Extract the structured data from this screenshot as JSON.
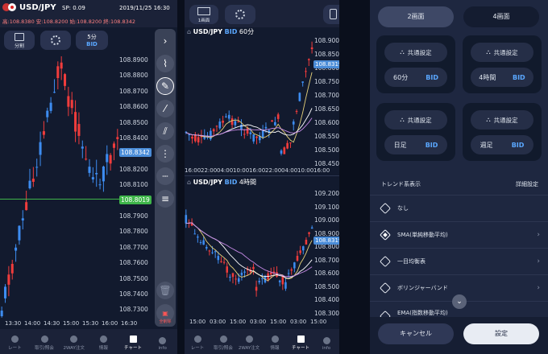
{
  "panel1": {
    "pair": "USD/JPY",
    "spread": "SP: 0.09",
    "datetime": "2019/11/25  16:30",
    "quotes": "高:108.8380  安:108.8200  始:108.8200  終:108.8342",
    "split_label": "分割",
    "timeframe_top": "5分",
    "timeframe_bottom": "BID",
    "price_labels": [
      "108.8900",
      "108.8800",
      "108.8700",
      "108.8600",
      "108.8500",
      "108.8400",
      "108.8300",
      "108.8200",
      "108.8100",
      "108.8000",
      "108.7900",
      "108.7800",
      "108.7700",
      "108.7600",
      "108.7500",
      "108.7400",
      "108.7300"
    ],
    "current_price": "108.8342",
    "line_price": "108.8019",
    "time_labels": [
      "13:30",
      "14:00",
      "14:30",
      "15:00",
      "15:30",
      "16:00",
      "16:30"
    ],
    "delete_all": "全削除"
  },
  "tabs": [
    "レート",
    "取引/照会",
    "2WAY注文",
    "情報",
    "チャート",
    "info"
  ],
  "panel2": {
    "top_label": "1画面",
    "chart1": {
      "pair": "USD/JPY",
      "side": "BID",
      "tf": "60分",
      "prices": [
        "108.9000",
        "108.8500",
        "108.8000",
        "108.7500",
        "108.7000",
        "108.6500",
        "108.6000",
        "108.5500",
        "108.5000",
        "108.4500"
      ],
      "current": "108.8319",
      "times": [
        "16:00",
        "22:00",
        "04:00",
        "10:00",
        "16:00",
        "22:00",
        "04:00",
        "10:00",
        "16:00"
      ]
    },
    "chart2": {
      "pair": "USD/JPY",
      "side": "BID",
      "tf": "4時間",
      "prices": [
        "109.2000",
        "109.1000",
        "109.0000",
        "108.9000",
        "108.8000",
        "108.7000",
        "108.6000",
        "108.5000",
        "108.4000",
        "108.3000"
      ],
      "current": "108.8319",
      "times": [
        "15:00",
        "03:00",
        "15:00",
        "03:00",
        "15:00",
        "03:00",
        "15:00"
      ]
    }
  },
  "panel3": {
    "tab_left": "2画面",
    "tab_right": "4画面",
    "cards": [
      {
        "setting": "共通設定",
        "tf": "60分",
        "side": "BID"
      },
      {
        "setting": "共通設定",
        "tf": "4時間",
        "side": "BID"
      },
      {
        "setting": "共通設定",
        "tf": "日足",
        "side": "BID"
      },
      {
        "setting": "共通設定",
        "tf": "週足",
        "side": "BID"
      }
    ],
    "trend_label": "トレンド系表示",
    "detail_label": "詳細設定",
    "options": [
      "なし",
      "SMA(単純移動平均)",
      "一目均衡表",
      "ボリンジャーバンド",
      "EMA(指数移動平均)"
    ],
    "cancel": "キャンセル",
    "ok": "設定"
  },
  "colors": {
    "up": "#f03c3c",
    "down": "#3d8cf0",
    "accent": "#5aa7ff",
    "green_line": "#3fb64a"
  }
}
